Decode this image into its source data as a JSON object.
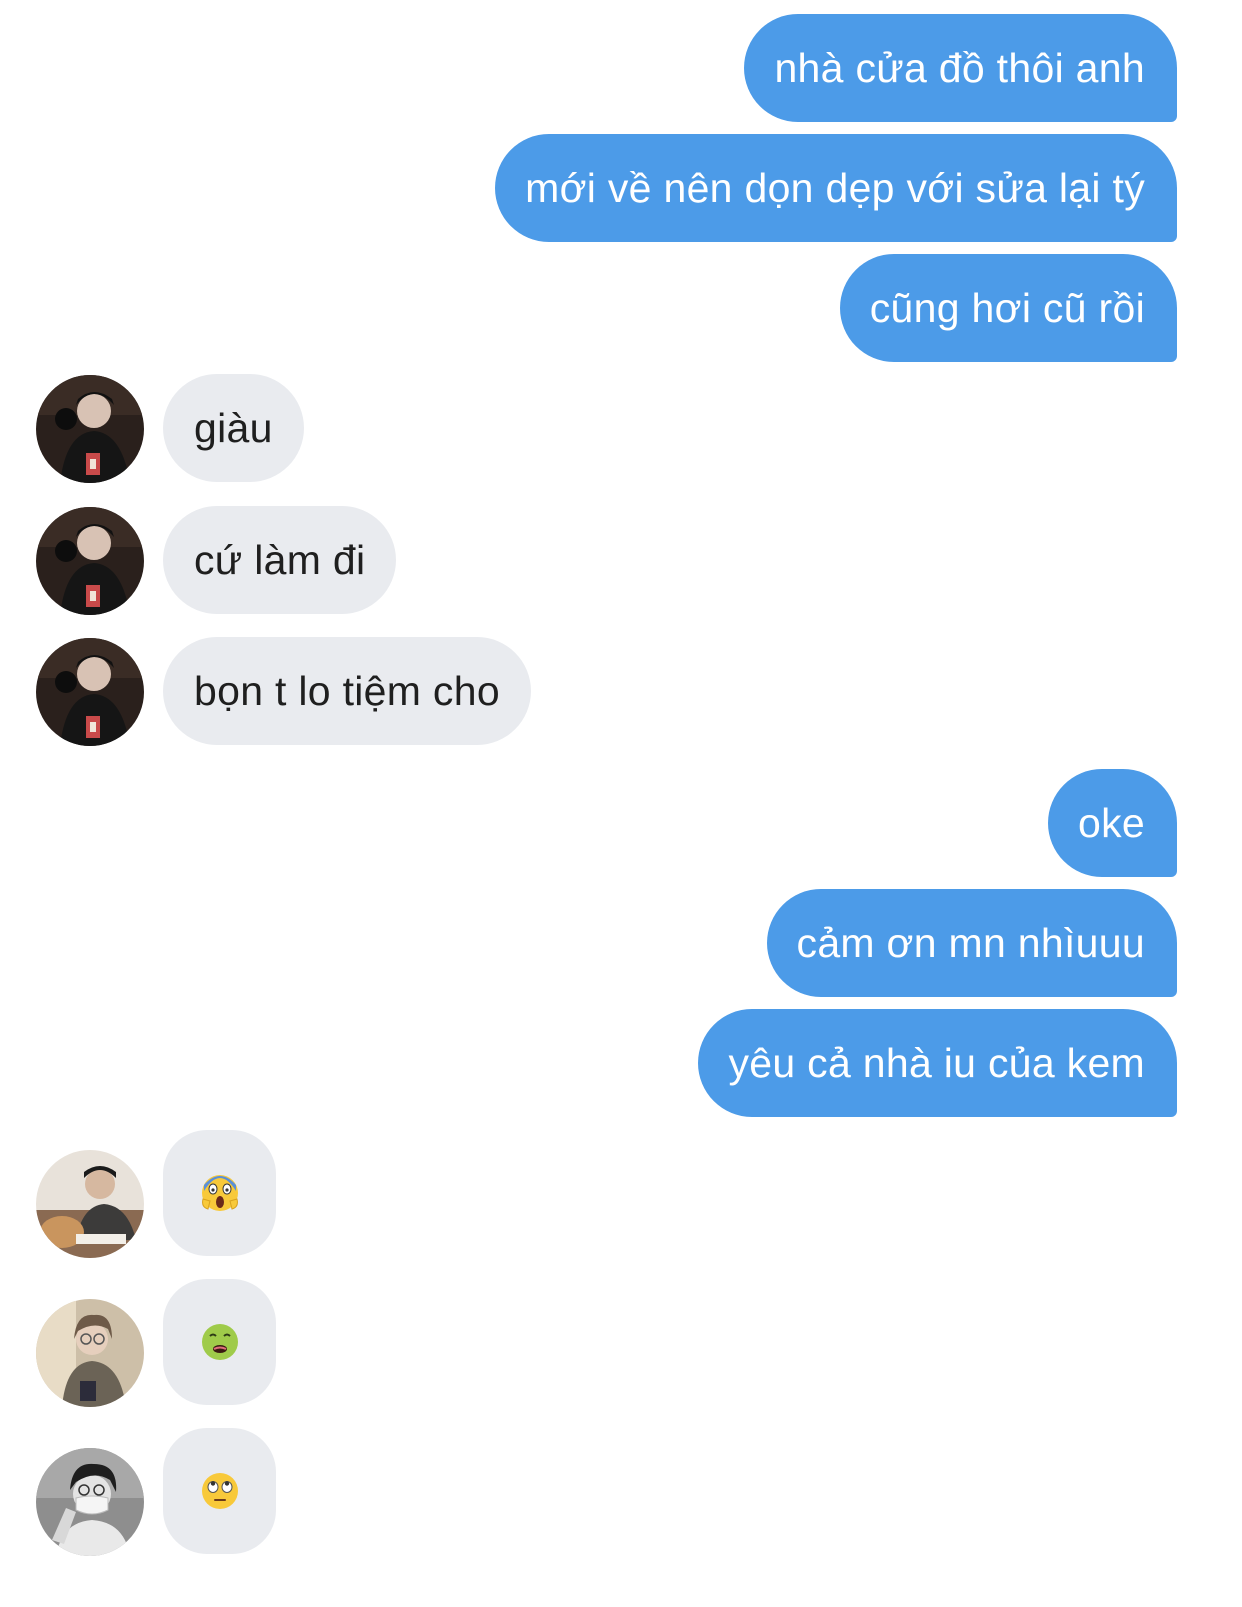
{
  "conversation": {
    "messages": [
      {
        "direction": "outgoing",
        "text": "nhà cửa đồ thôi anh"
      },
      {
        "direction": "outgoing",
        "text": "mới về nên dọn dẹp với sửa lại tý"
      },
      {
        "direction": "outgoing",
        "text": "cũng hơi cũ rồi"
      },
      {
        "direction": "incoming",
        "text": "giàu",
        "avatar": "avatar-photo-1"
      },
      {
        "direction": "incoming",
        "text": "cứ làm đi",
        "avatar": "avatar-photo-1"
      },
      {
        "direction": "incoming",
        "text": "bọn t lo tiệm cho",
        "avatar": "avatar-photo-1"
      },
      {
        "direction": "outgoing",
        "text": "oke"
      },
      {
        "direction": "outgoing",
        "text": "cảm ơn mn nhìuuu"
      },
      {
        "direction": "outgoing",
        "text": "yêu cả nhà iu của kem"
      },
      {
        "direction": "incoming",
        "reaction_icon": "screaming-face-emoji",
        "avatar": "avatar-photo-2"
      },
      {
        "direction": "incoming",
        "reaction_icon": "nauseated-face-emoji",
        "avatar": "avatar-photo-3"
      },
      {
        "direction": "incoming",
        "reaction_icon": "rolling-eyes-emoji",
        "avatar": "avatar-photo-4"
      }
    ]
  },
  "colors": {
    "outgoing_bubble": "#4c9be8",
    "incoming_bubble": "#e9ebef",
    "outgoing_text": "#ffffff",
    "incoming_text": "#1f1f1f"
  }
}
